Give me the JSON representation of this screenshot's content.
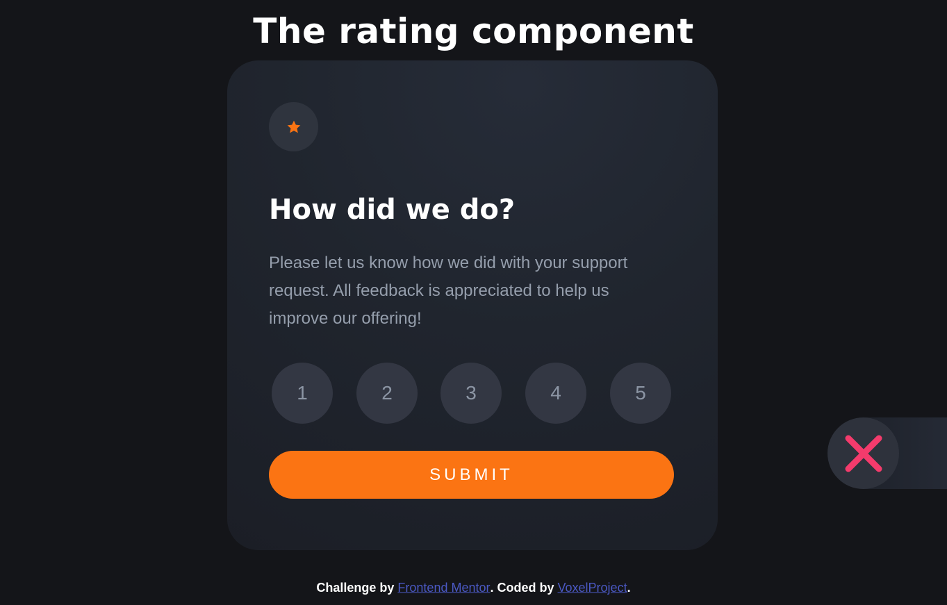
{
  "page": {
    "title": "The rating component"
  },
  "card": {
    "star_icon": "star-icon",
    "heading": "How did we do?",
    "text": "Please let us know how we did with your support request. All feedback is appreciated to help us improve our offering!",
    "ratings": [
      "1",
      "2",
      "3",
      "4",
      "5"
    ],
    "submit_label": "SUBMIT"
  },
  "side": {
    "close_icon": "close-icon"
  },
  "footer": {
    "challenge_prefix": "Challenge by ",
    "challenge_link": "Frontend Mentor",
    "coded_prefix": ". Coded by ",
    "coded_link": "VoxelProject",
    "suffix": "."
  },
  "colors": {
    "background": "#141519",
    "card": "#20252e",
    "accent": "#fb7413",
    "rating_bg": "#333743",
    "text_muted": "#959eac",
    "close_icon": "#f43b6c",
    "link": "#4b59c4"
  }
}
